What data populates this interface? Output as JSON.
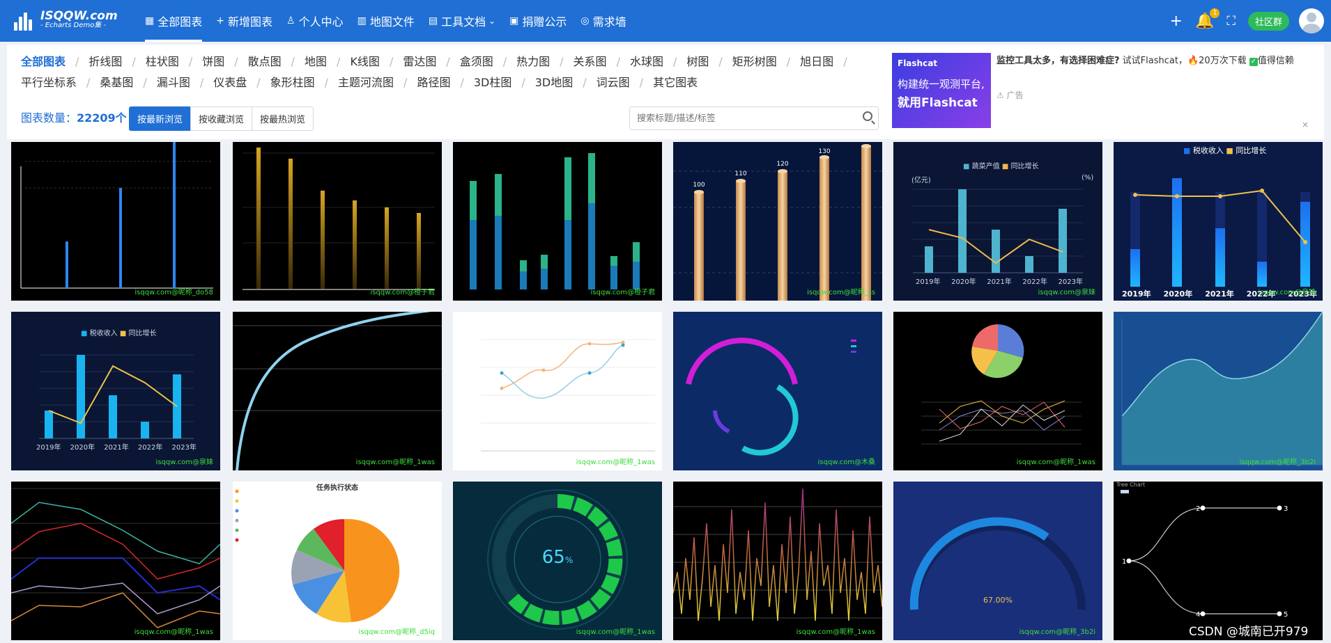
{
  "header": {
    "logo_title": "ISQQW.com",
    "logo_subtitle": "- Echarts Demo集 -",
    "nav": [
      {
        "label": "全部图表",
        "icon": "grid-icon",
        "glyph": "▦",
        "active": true
      },
      {
        "label": "新增图表",
        "icon": "plus-icon",
        "glyph": "+"
      },
      {
        "label": "个人中心",
        "icon": "user-icon",
        "glyph": "♙"
      },
      {
        "label": "地图文件",
        "icon": "map-icon",
        "glyph": "▥"
      },
      {
        "label": "工具文档",
        "icon": "document-icon",
        "glyph": "▤",
        "dropdown": true
      },
      {
        "label": "捐赠公示",
        "icon": "donate-icon",
        "glyph": "▣"
      },
      {
        "label": "需求墙",
        "icon": "compass-icon",
        "glyph": "◎"
      }
    ],
    "notification_count": "1",
    "community_label": "社区群"
  },
  "categories": [
    "全部图表",
    "折线图",
    "柱状图",
    "饼图",
    "散点图",
    "地图",
    "K线图",
    "雷达图",
    "盒须图",
    "热力图",
    "关系图",
    "水球图",
    "树图",
    "矩形树图",
    "旭日图",
    "平行坐标系",
    "桑基图",
    "漏斗图",
    "仪表盘",
    "象形柱图",
    "主题河流图",
    "路径图",
    "3D柱图",
    "3D地图",
    "词云图",
    "其它图表"
  ],
  "count_label": "图表数量：",
  "count_value": "22209个",
  "sort_options": [
    "按最新浏览",
    "按收藏浏览",
    "按最热浏览"
  ],
  "search": {
    "placeholder": "搜索标题/描述/标签"
  },
  "ad": {
    "brand": "Flashcat",
    "line1": "构建统一观测平台,",
    "line2": "就用Flashcat",
    "text_bold": "监控工具太多，有选择困难症?",
    "text_rest": " 试试Flashcat，",
    "downloads": "20万次下载",
    "trusted": "值得信赖",
    "label": "广告",
    "close": "×"
  },
  "cards": [
    {
      "watermark": "isqqw.com@昵称_do58"
    },
    {
      "watermark": "isqqw.com@橙子君"
    },
    {
      "watermark": "isqqw.com@橙子君"
    },
    {
      "watermark": "isqqw.com@昵称_ss"
    },
    {
      "watermark": "isqqw.com@泉妹",
      "legend": [
        "蔬菜产值",
        "同比增长"
      ],
      "years": [
        "2019年",
        "2020年",
        "2021年",
        "2022年",
        "2023年"
      ],
      "unit_left": "(亿元)",
      "unit_right": "(%)"
    },
    {
      "watermark": "isqqw.com@泉妹",
      "legend": [
        "税收收入",
        "同比增长"
      ],
      "years": [
        "2019年",
        "2020年",
        "2021年",
        "2022年",
        "2023年"
      ]
    },
    {
      "watermark": "isqqw.com@泉妹",
      "legend": [
        "税收收入",
        "同比增长"
      ],
      "years": [
        "2019年",
        "2020年",
        "2021年",
        "2022年",
        "2023年"
      ]
    },
    {
      "watermark": "isqqw.com@昵称_1was"
    },
    {
      "watermark": "isqqw.com@昵称_1was"
    },
    {
      "watermark": "isqqw.com@木桑"
    },
    {
      "watermark": "isqqw.com@昵称_1was"
    },
    {
      "watermark": "isqqw.com@昵称_3b2i"
    },
    {
      "watermark": "isqqw.com@昵称_1was"
    },
    {
      "watermark": "isqqw.com@昵称_d5iq",
      "title": "任务执行状态"
    },
    {
      "watermark": "isqqw.com@昵称_1was",
      "value": "65",
      "unit": "%"
    },
    {
      "watermark": "isqqw.com@昵称_1was"
    },
    {
      "watermark": "isqqw.com@昵称_3b2i",
      "value": "67.00%"
    },
    {
      "watermark": "",
      "title": "Tree Chart"
    }
  ],
  "csdn": "CSDN @城南已开979"
}
